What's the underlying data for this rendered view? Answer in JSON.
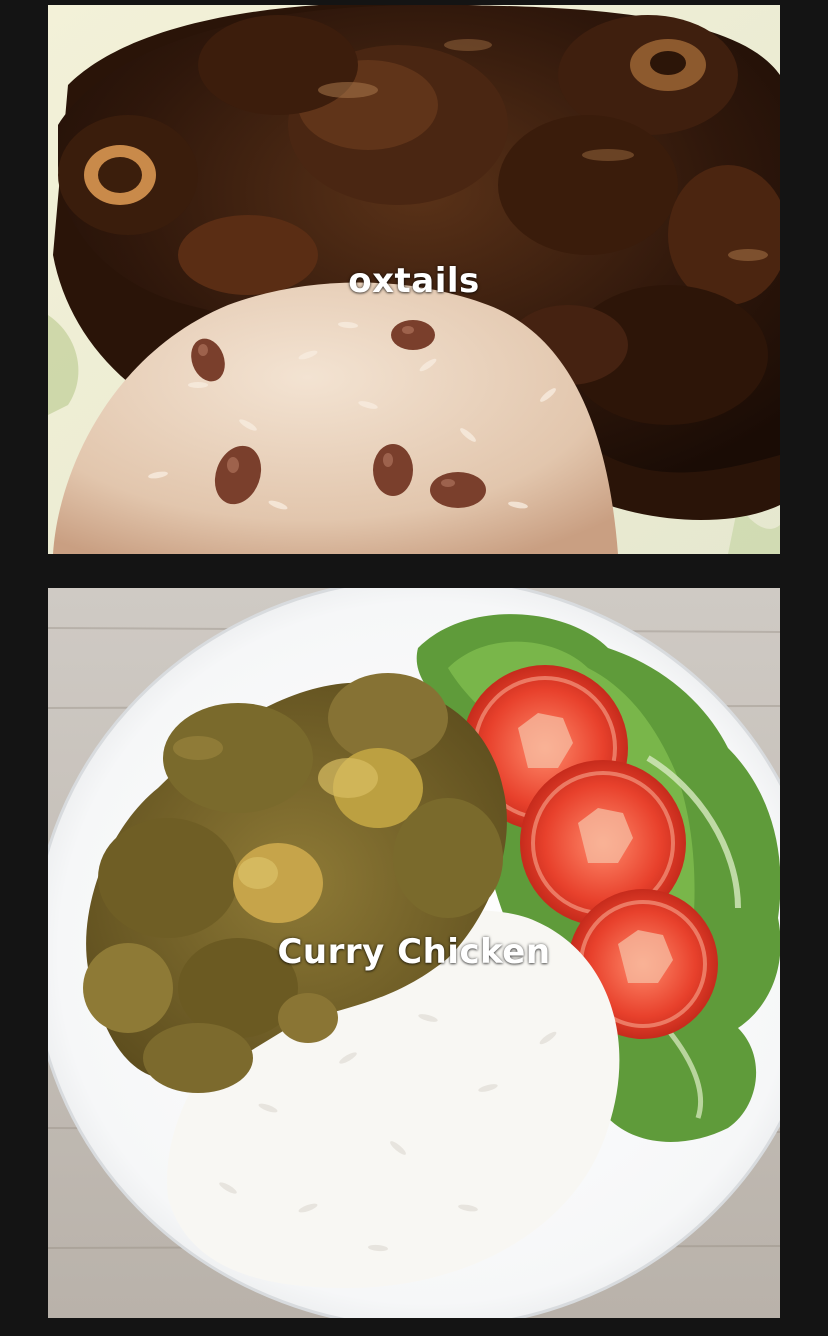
{
  "photos": [
    {
      "caption": "oxtails"
    },
    {
      "caption": "Curry Chicken"
    }
  ],
  "colors": {
    "background": "#141414",
    "caption": "#ffffff"
  }
}
